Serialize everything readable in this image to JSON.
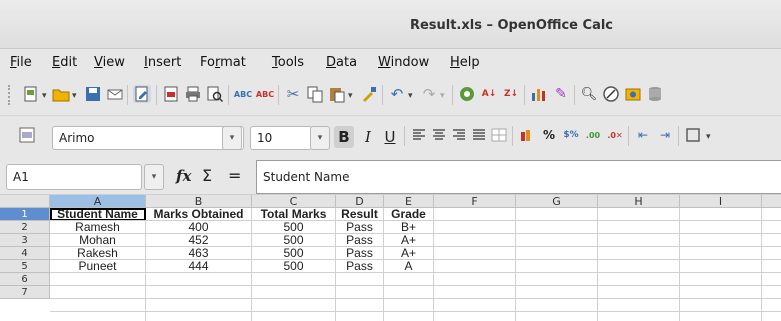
{
  "window": {
    "title": "Result.xls – OpenOffice Calc"
  },
  "menu": [
    {
      "pre": "",
      "u": "F",
      "post": "ile"
    },
    {
      "pre": "",
      "u": "E",
      "post": "dit"
    },
    {
      "pre": "",
      "u": "V",
      "post": "iew"
    },
    {
      "pre": "",
      "u": "I",
      "post": "nsert"
    },
    {
      "pre": "Fo",
      "u": "r",
      "post": "mat"
    },
    {
      "pre": "",
      "u": "T",
      "post": "ools"
    },
    {
      "pre": "",
      "u": "D",
      "post": "ata"
    },
    {
      "pre": "",
      "u": "W",
      "post": "indow"
    },
    {
      "pre": "",
      "u": "H",
      "post": "elp"
    }
  ],
  "formatting": {
    "font_name": "Arimo",
    "font_size": "10",
    "bold_label": "B",
    "italic_label": "I",
    "underline_label": "U"
  },
  "formula": {
    "cell_ref": "A1",
    "fx_label": "fx",
    "sum_label": "Σ",
    "equals_label": "=",
    "content": "Student Name"
  },
  "sheet": {
    "columns": [
      "A",
      "B",
      "C",
      "D",
      "E",
      "F",
      "G",
      "H",
      "I"
    ],
    "rows": [
      "1",
      "2",
      "3",
      "4",
      "5",
      "6",
      "7"
    ],
    "selected_column": "A",
    "selected_row": "1",
    "cells": [
      [
        "Student Name",
        "Marks Obtained",
        "Total Marks",
        "Result",
        "Grade"
      ],
      [
        "Ramesh",
        "400",
        "500",
        "Pass",
        "B+"
      ],
      [
        "Mohan",
        "452",
        "500",
        "Pass",
        "A+"
      ],
      [
        "Rakesh",
        "463",
        "500",
        "Pass",
        "A+"
      ],
      [
        "Puneet",
        "444",
        "500",
        "Pass",
        "A"
      ]
    ]
  },
  "icons": {
    "toolbar1": [
      "new-document-icon",
      "open-folder-icon",
      "save-icon",
      "email-icon",
      "edit-file-icon",
      "export-pdf-icon",
      "print-icon",
      "page-preview-icon",
      "spellcheck-icon",
      "autospellcheck-icon",
      "cut-icon",
      "copy-icon",
      "paste-icon",
      "clone-formatting-icon",
      "undo-icon",
      "redo-icon",
      "hyperlink-icon",
      "sort-ascending-icon",
      "sort-descending-icon",
      "chart-icon",
      "draw-functions-icon",
      "find-replace-icon",
      "navigator-icon",
      "gallery-icon"
    ],
    "toolbar2": [
      "styles-formatting-icon",
      "align-left-icon",
      "align-center-icon",
      "align-right-icon",
      "justify-icon",
      "merge-cells-icon",
      "currency-icon",
      "percent-icon",
      "standard-format-icon",
      "add-decimal-icon",
      "delete-decimal-icon",
      "decrease-indent-icon",
      "increase-indent-icon",
      "borders-icon"
    ]
  },
  "colors": {
    "selected_header": "#9bc0e6",
    "selected_row_header": "#5f8ed0",
    "chrome": "#e7e7e7"
  }
}
